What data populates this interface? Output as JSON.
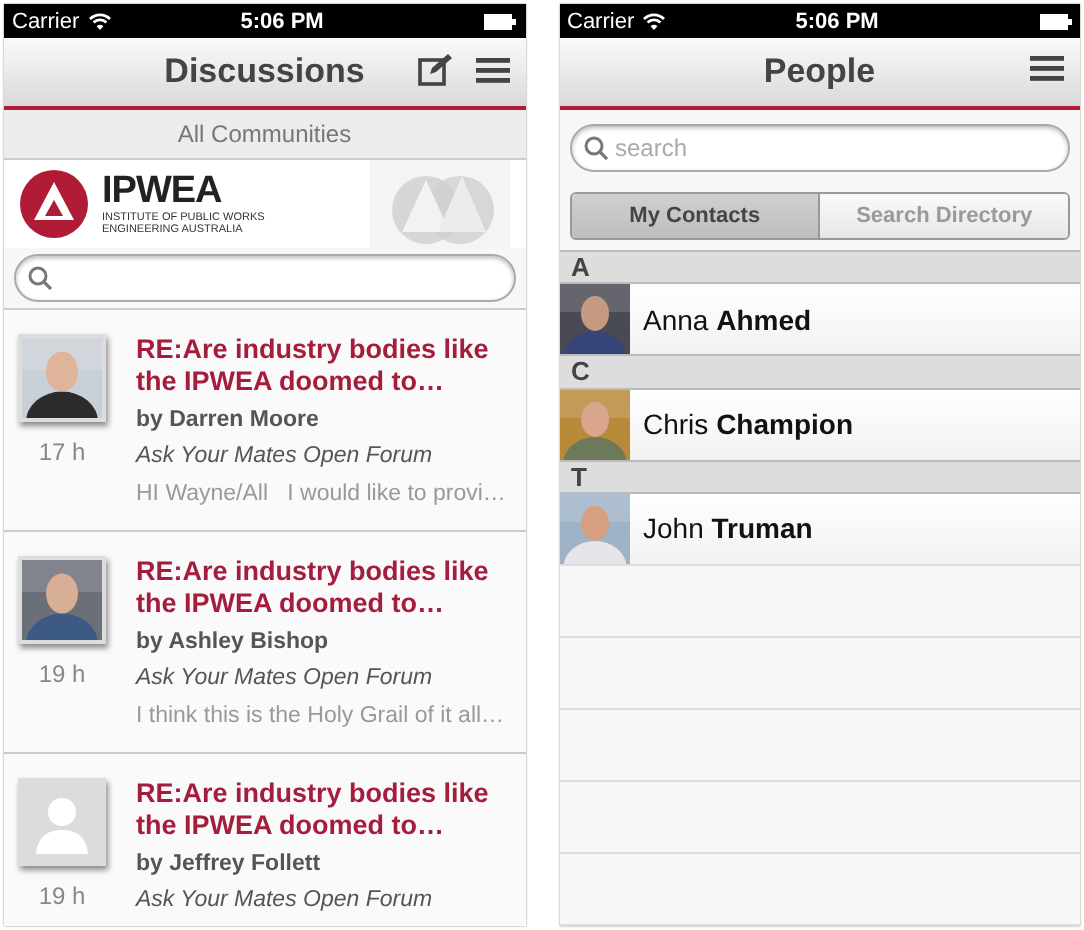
{
  "screens": [
    {
      "kind": "discussions",
      "status_bar": {
        "carrier": "Carrier",
        "time": "5:06 PM"
      },
      "nav": {
        "title": "Discussions",
        "buttons": [
          {
            "kind": "compose"
          },
          {
            "kind": "menu"
          }
        ]
      },
      "filter": "All Communities",
      "banner": {
        "name": "IPWEA",
        "line_1": "INSTITUTE OF PUBLIC WORKS",
        "line_2": "ENGINEERING AUSTRALIA"
      },
      "posts": [
        {
          "kind": "picture",
          "age": "17 h",
          "title": "RE:Are industry bodies like the IPWEA doomed to…",
          "author": "by Darren Moore",
          "forum": "Ask Your Mates Open Forum",
          "preview": "HI Wayne/All   I would like to provi…"
        },
        {
          "kind": "picture",
          "age": "19 h",
          "title": "RE:Are industry bodies like the IPWEA doomed to…",
          "author": "by Ashley Bishop",
          "forum": "Ask Your Mates Open Forum",
          "preview": "I think this is the Holy Grail of it all…"
        },
        {
          "kind": "placeholder",
          "age": "19 h",
          "title": "RE:Are industry bodies like the IPWEA doomed to…",
          "author": "by Jeffrey Follett",
          "forum": "Ask Your Mates Open Forum"
        }
      ]
    },
    {
      "kind": "people",
      "status_bar": {
        "carrier": "Carrier",
        "time": "5:06 PM"
      },
      "nav": {
        "title": "People",
        "buttons": [
          {
            "kind": "menu"
          }
        ]
      },
      "search": {
        "placeholder": "search"
      },
      "segments": [
        {
          "label": "My Contacts",
          "selected": true
        },
        {
          "label": "Search Directory",
          "selected": false
        }
      ],
      "sections": [
        {
          "letter": "A",
          "contacts": [
            {
              "name": "Anna **Ahmed**"
            }
          ]
        },
        {
          "letter": "C",
          "contacts": [
            {
              "name": "Chris **Champion**"
            }
          ]
        },
        {
          "letter": "T",
          "contacts": [
            {
              "name": "John **Truman**"
            }
          ]
        }
      ]
    }
  ]
}
